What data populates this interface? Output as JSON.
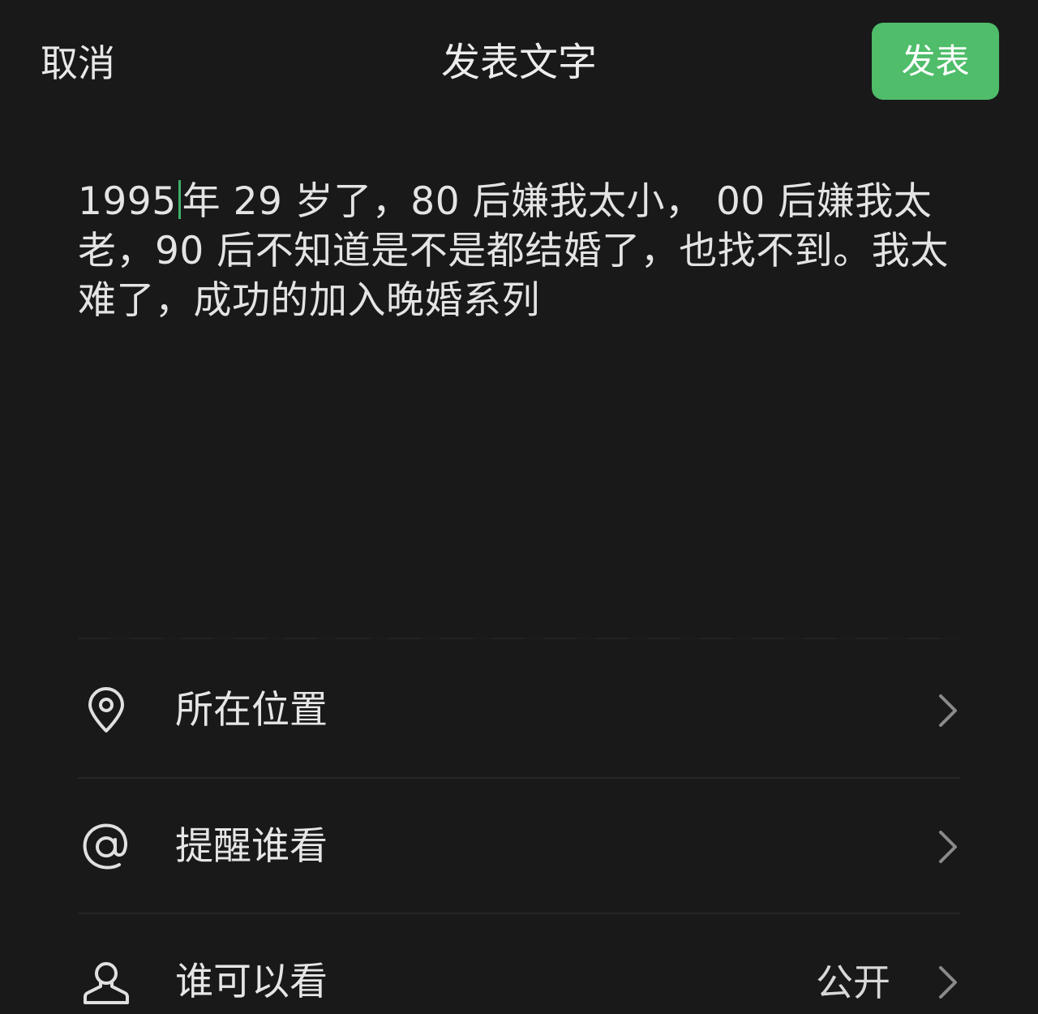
{
  "header": {
    "cancel_label": "取消",
    "title": "发表文字",
    "publish_label": "发表"
  },
  "post": {
    "text_before_caret": "1995",
    "text_after_caret": "年 29 岁了，80 后嫌我太小， 00 后嫌我太老，90 后不知道是不是都结婚了，也找不到。我太难了，成功的加入晚婚系列"
  },
  "options": [
    {
      "label": "所在位置",
      "value": "",
      "icon": "location-pin-icon"
    },
    {
      "label": "提醒谁看",
      "value": "",
      "icon": "at-sign-icon"
    },
    {
      "label": "谁可以看",
      "value": "公开",
      "icon": "person-icon"
    }
  ],
  "colors": {
    "background": "#191919",
    "publish_button": "#4fbd6a",
    "caret": "#3db06a"
  }
}
